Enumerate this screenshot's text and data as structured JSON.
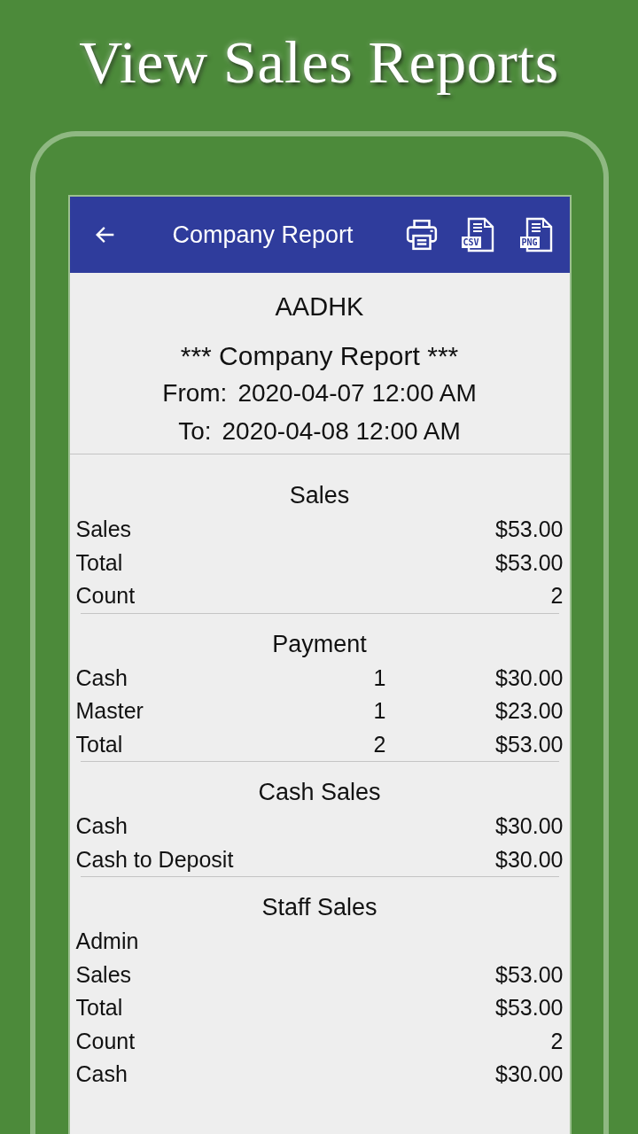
{
  "headline": "View Sales Reports",
  "app_bar": {
    "title": "Company Report",
    "actions": [
      {
        "kind": "print"
      },
      {
        "kind": "file",
        "label": "CSV"
      },
      {
        "kind": "file",
        "label": "PNG"
      }
    ]
  },
  "report": {
    "company": "AADHK",
    "title": "*** Company Report ***",
    "from_label": "From:",
    "from_value": "2020-04-07 12:00 AM",
    "to_label": "To:",
    "to_value": "2020-04-08 12:00 AM",
    "sections": [
      {
        "title": "Sales",
        "rows": [
          {
            "label": "Sales",
            "amount": "$53.00"
          },
          {
            "label": "Total",
            "amount": "$53.00"
          },
          {
            "label": "Count",
            "amount": "2"
          }
        ]
      },
      {
        "title": "Payment",
        "rows": [
          {
            "label": "Cash",
            "count": "1",
            "amount": "$30.00"
          },
          {
            "label": "Master",
            "count": "1",
            "amount": "$23.00"
          },
          {
            "label": "Total",
            "count": "2",
            "amount": "$53.00"
          }
        ]
      },
      {
        "title": "Cash Sales",
        "rows": [
          {
            "label": "Cash",
            "amount": "$30.00"
          },
          {
            "label": "Cash to Deposit",
            "amount": "$30.00"
          }
        ]
      },
      {
        "title": "Staff Sales",
        "rows": [
          {
            "label": "Admin"
          },
          {
            "label": "Sales",
            "amount": "$53.00"
          },
          {
            "label": "Total",
            "amount": "$53.00"
          },
          {
            "label": "Count",
            "amount": "2"
          },
          {
            "label": "Cash",
            "amount": "$30.00"
          }
        ]
      }
    ]
  }
}
